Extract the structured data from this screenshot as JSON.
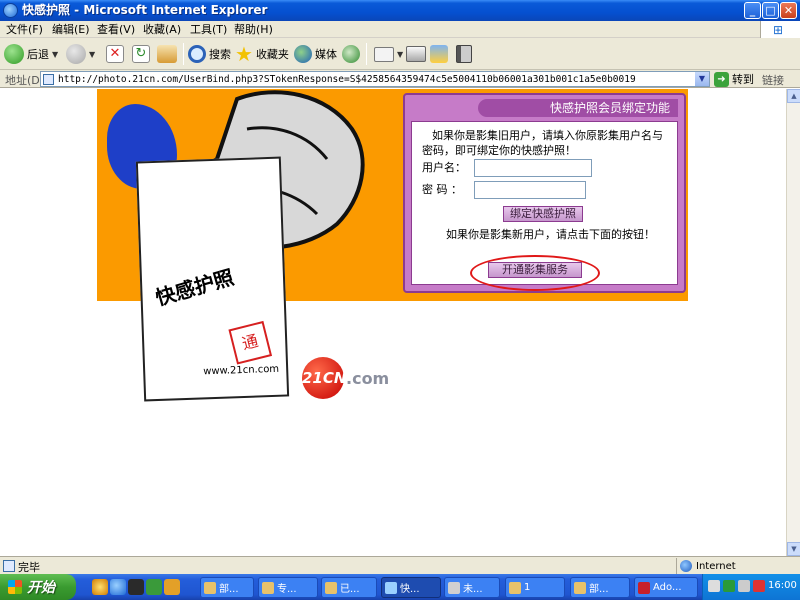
{
  "window": {
    "title": "快感护照 - Microsoft Internet Explorer",
    "min_label": "_",
    "max_label": "□",
    "close_label": "✕"
  },
  "menu": [
    "文件(F)",
    "编辑(E)",
    "查看(V)",
    "收藏(A)",
    "工具(T)",
    "帮助(H)"
  ],
  "toolbar": {
    "back": "后退",
    "search": "搜索",
    "favorites": "收藏夹",
    "media": "媒体"
  },
  "address": {
    "label": "地址(D)",
    "url": "http://photo.21cn.com/UserBind.php3?STokenResponse=S$4258564359474c5e5004110b06001a301b001c1a5e0b0019",
    "go": "转到",
    "links": "链接"
  },
  "page": {
    "card_title": "快感护照",
    "card_url": "www.21cn.com",
    "brand_logo": "21CN",
    "brand_dotcom": ".com",
    "panel": {
      "header": "快感护照会员绑定功能",
      "intro": "如果你是影集旧用户，请填入你原影集用户名与密码，即可绑定你的快感护照！",
      "username_label": "用户名：",
      "password_label": "密  码 ：",
      "username_value": "",
      "password_value": "",
      "bind_button": "绑定快感护照",
      "new_user_text": "如果你是影集新用户，请点击下面的按钮！",
      "open_button": "开通影集服务"
    }
  },
  "status": {
    "text": "完毕",
    "zone": "Internet"
  },
  "taskbar": {
    "start": "开始",
    "tasks": [
      "部...",
      "专...",
      "已...",
      "快...",
      "未...",
      "1",
      "部...",
      "Ado..."
    ],
    "active_index": 3,
    "clock": "16:00"
  }
}
